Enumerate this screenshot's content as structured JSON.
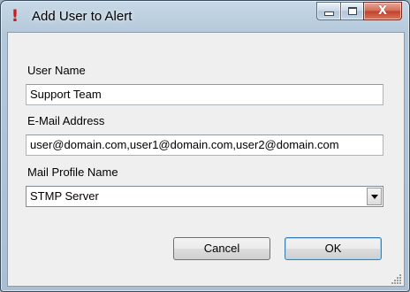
{
  "window": {
    "title": "Add User to Alert",
    "icon": "exclamation-icon",
    "controls": {
      "minimize": "minimize-icon",
      "maximize": "maximize-icon",
      "close": "X"
    }
  },
  "form": {
    "user_name": {
      "label": "User Name",
      "value": "Support Team"
    },
    "email": {
      "label": "E-Mail Address",
      "value": "user@domain.com,user1@domain.com,user2@domain.com"
    },
    "mail_profile": {
      "label": "Mail Profile Name",
      "selected": "STMP Server"
    }
  },
  "buttons": {
    "cancel": "Cancel",
    "ok": "OK"
  },
  "colors": {
    "title_icon": "#d01a1a",
    "close_button": "#c0402a",
    "default_button_border": "#3c7fb1"
  }
}
